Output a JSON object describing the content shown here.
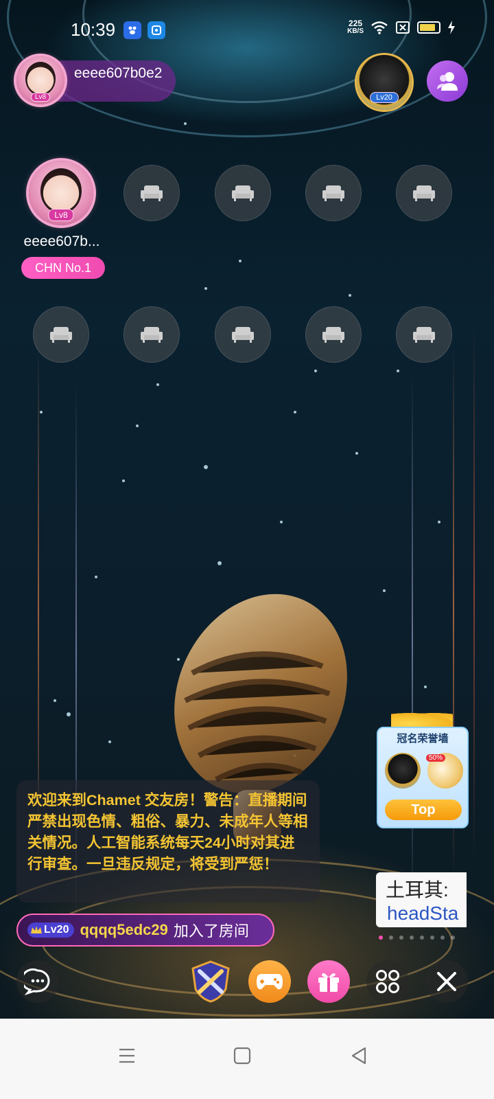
{
  "status_bar": {
    "time": "10:39",
    "net_speed_value": "225",
    "net_speed_unit": "KB/S",
    "icons": [
      "baidu-app-icon",
      "blue-app-icon",
      "wifi-icon",
      "no-sim-icon",
      "battery-icon",
      "charging-icon"
    ]
  },
  "room": {
    "host_name": "eeee607b0e2",
    "host_level": "Lv8",
    "top_user_level": "Lv20",
    "seat_host_name": "eeee607b...",
    "seat_host_level": "Lv8",
    "seat_host_tag": "CHN No.1",
    "empty_seat_count": 9,
    "empty_seat_icon": "sofa-icon"
  },
  "notice": {
    "text": "欢迎来到Chamet 交友房！警告：直播期间严禁出现色情、粗俗、暴力、未成年人等相关情况。人工智能系统每天24小时对其进行审查。一旦违反规定，将受到严惩！"
  },
  "join_message": {
    "level": "Lv20",
    "user": "qqqq5edc29",
    "action": "加入了房间"
  },
  "honor_wall": {
    "title": "冠名荣誉墙",
    "badge": "50%",
    "button": "Top"
  },
  "news_ticker": {
    "line1": "土耳其:",
    "line2": "headSta",
    "active_dot": 0,
    "dot_count": 8
  },
  "toolbar": {
    "buttons": [
      "chat-icon",
      "battle-icon",
      "game-icon",
      "gift-icon",
      "more-apps-icon",
      "close-icon"
    ]
  },
  "nav_bar": {
    "buttons": [
      "menu-icon",
      "home-icon",
      "back-icon"
    ]
  },
  "colors": {
    "accent_pink": "#ff4fb0",
    "notice_yellow": "#f4c433",
    "purple": "#8b3ad6"
  }
}
